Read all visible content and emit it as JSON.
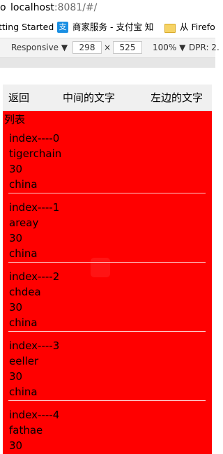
{
  "browser": {
    "address": {
      "prefix": "o",
      "host": "localhost",
      "rest": ":8081/#/"
    },
    "bookmarks": [
      {
        "label": "tting Started",
        "icon": ""
      },
      {
        "label": "商家服务 - 支付宝 知",
        "icon": "alipay-icon",
        "glyph": "支"
      },
      {
        "label": "从 Firefox",
        "icon": "folder-icon"
      }
    ],
    "device_toolbar": {
      "device": "Responsive",
      "width": "298",
      "times": "×",
      "height": "525",
      "zoom": "100%",
      "dpr": "DPR: 2."
    }
  },
  "app": {
    "header": {
      "back": "返回",
      "middle": "中间的文字",
      "right": "左边的文字"
    },
    "list_title": "列表",
    "items": [
      {
        "index": "index----0",
        "name": "tigerchain",
        "age": "30",
        "country": "china"
      },
      {
        "index": "index----1",
        "name": "areay",
        "age": "30",
        "country": "china"
      },
      {
        "index": "index----2",
        "name": "chdea",
        "age": "30",
        "country": "china"
      },
      {
        "index": "index----3",
        "name": "eeller",
        "age": "30",
        "country": "china"
      },
      {
        "index": "index----4",
        "name": "fathae",
        "age": "30",
        "country": ""
      }
    ],
    "colors": {
      "list_bg": "#ff0000",
      "header_bg": "#f0f0f0",
      "separator": "#ffcccc"
    }
  }
}
